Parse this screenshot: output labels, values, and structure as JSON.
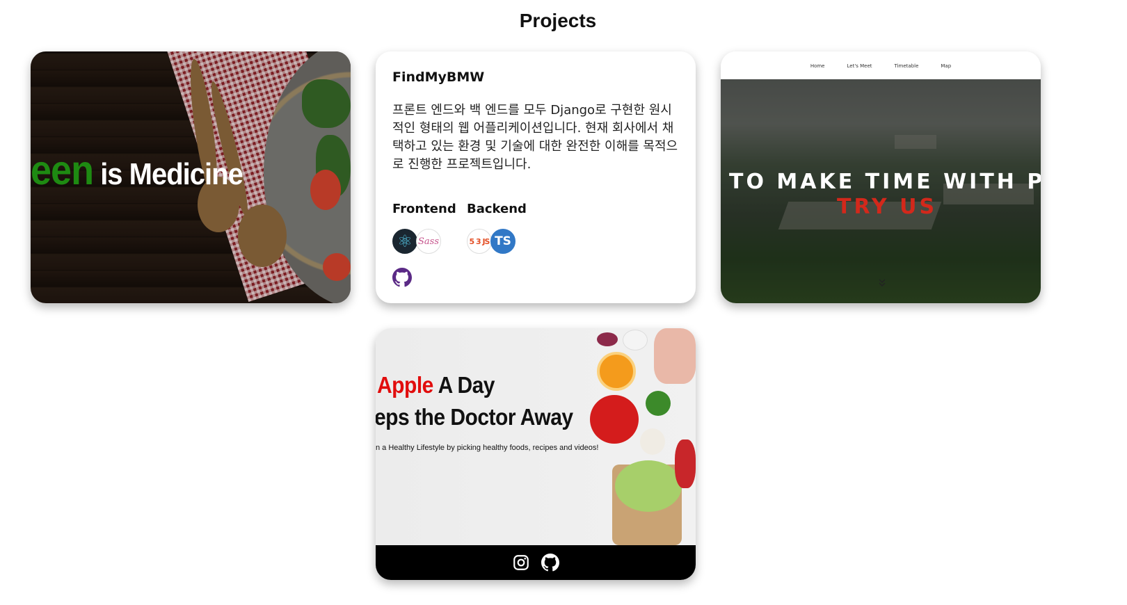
{
  "page": {
    "title": "Projects"
  },
  "cards": [
    {
      "image_text_green": "een",
      "image_text_white": "is Medicine"
    },
    {
      "title": "FindMyBMW",
      "description": "프론트 엔드와 백 엔드를 모두 Django로 구현한 원시적인 형태의 웹 어플리케이션입니다. 현재 회사에서 채택하고 있는 환경 및 기술에 대한 완전한 이해를 목적으로 진행한 프로젝트입니다.",
      "frontend_label": "Frontend",
      "backend_label": "Backend",
      "frontend_icons": [
        "react-icon",
        "sass-icon"
      ],
      "backend_icons": [
        "html-css-js-icon",
        "typescript-icon"
      ],
      "html_icon_text": "5 3 JS",
      "ts_icon_text": "TS",
      "link_icon": "github-icon"
    },
    {
      "nav": [
        "Home",
        "Let's Meet",
        "Timetable",
        "Map"
      ],
      "headline": "TO MAKE TIME WITH PE",
      "cta": "TRY US"
    },
    {
      "line1_red": "Apple",
      "line1_black": " A Day",
      "line2": "eps the Doctor Away",
      "subtitle": "n a Healthy Lifestyle by picking healthy foods, recipes and videos!",
      "footer_icons": [
        "instagram-icon",
        "github-icon"
      ]
    }
  ],
  "colors": {
    "accent_green": "#1e8a12",
    "accent_red": "#e10d0d",
    "cta_red": "#d3281b",
    "github_purple": "#5b2a86"
  }
}
